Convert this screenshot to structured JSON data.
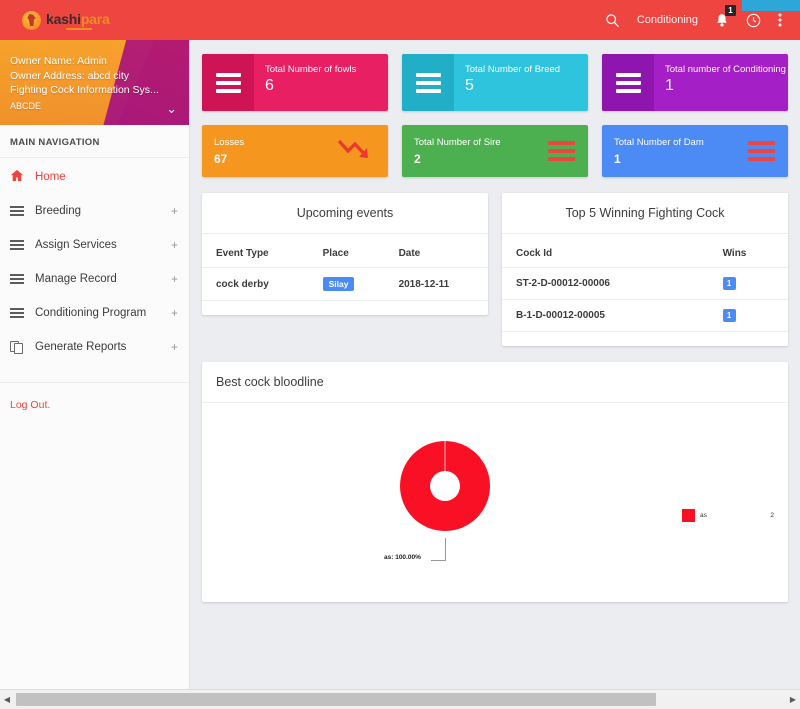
{
  "topbar": {
    "logo_first": "kashi",
    "logo_second": "para",
    "search_icon": "search-icon",
    "conditioning_label": "Conditioning",
    "bell_icon": "bell-icon",
    "bell_badge": "1",
    "clock_icon": "clock-icon",
    "overflow_icon": "vertical-dots-icon",
    "bg_color": "#ee4540",
    "accent_color": "#2da7d8"
  },
  "sidebar": {
    "owner_name": "Owner Name: Admin",
    "owner_address": "Owner Address: abcd city",
    "system_name": "Fighting Cock Information Sys...",
    "owner_code": "ABCDE",
    "caret_icon": "chevron-down-icon",
    "nav_title": "MAIN NAVIGATION",
    "items": [
      {
        "label": "Home",
        "icon": "home-icon",
        "expand": "",
        "active": true
      },
      {
        "label": "Breeding",
        "icon": "list-icon",
        "expand": "+",
        "active": false
      },
      {
        "label": "Assign Services",
        "icon": "list-icon",
        "expand": "+",
        "active": false
      },
      {
        "label": "Manage Record",
        "icon": "list-icon",
        "expand": "+",
        "active": false
      },
      {
        "label": "Conditioning Program",
        "icon": "list-icon",
        "expand": "+",
        "active": false
      },
      {
        "label": "Generate Reports",
        "icon": "copy-icon",
        "expand": "+",
        "active": false
      }
    ],
    "logout_label": "Log Out."
  },
  "stats_row1": [
    {
      "title": "Total Number of fowls",
      "value": "6",
      "color": "#e81f63",
      "icon_bg": "#cf1455",
      "icon": "menu-bars-icon"
    },
    {
      "title": "Total Number of Breed",
      "value": "5",
      "color": "#2ec4de",
      "icon_bg": "#22aec6",
      "icon": "menu-bars-icon"
    },
    {
      "title": "Total number of Conditioning",
      "value": "1",
      "color": "#a41fc6",
      "icon_bg": "#8e16ae",
      "icon": "menu-bars-icon"
    }
  ],
  "stats_row2": [
    {
      "title": "Losses",
      "value": "67",
      "color": "#f5971e",
      "icon": "trend-down-icon"
    },
    {
      "title": "Total Number of Sire",
      "value": "2",
      "color": "#4caf50",
      "icon": "menu-bars-icon"
    },
    {
      "title": "Total Number of Dam",
      "value": "1",
      "color": "#4c8bf5",
      "icon": "menu-bars-icon"
    }
  ],
  "events_panel": {
    "title": "Upcoming events",
    "columns": [
      "Event Type",
      "Place",
      "Date"
    ],
    "rows": [
      {
        "event_type": "cock derby",
        "place": "Silay",
        "date": "2018-12-11"
      }
    ]
  },
  "winners_panel": {
    "title": "Top 5 Winning Fighting Cock",
    "columns": [
      "Cock Id",
      "Wins"
    ],
    "rows": [
      {
        "cock_id": "ST-2-D-00012-00006",
        "wins": "1"
      },
      {
        "cock_id": "B-1-D-00012-00005",
        "wins": "1"
      }
    ]
  },
  "chart_panel": {
    "title": "Best cock bloodline"
  },
  "chart_data": {
    "type": "pie",
    "title": "Best cock bloodline",
    "categories": [
      "as"
    ],
    "values": [
      2
    ],
    "percentages": [
      "100.00%"
    ],
    "colors": [
      "#fa1025"
    ],
    "data_labels": [
      "as: 100.00%"
    ],
    "legend": [
      {
        "name": "as",
        "value": "2",
        "color": "#fa1025"
      }
    ],
    "legend_position": "right",
    "donut": true
  },
  "scrollbar": {
    "left_arrow": "◀",
    "right_arrow": "▶"
  }
}
